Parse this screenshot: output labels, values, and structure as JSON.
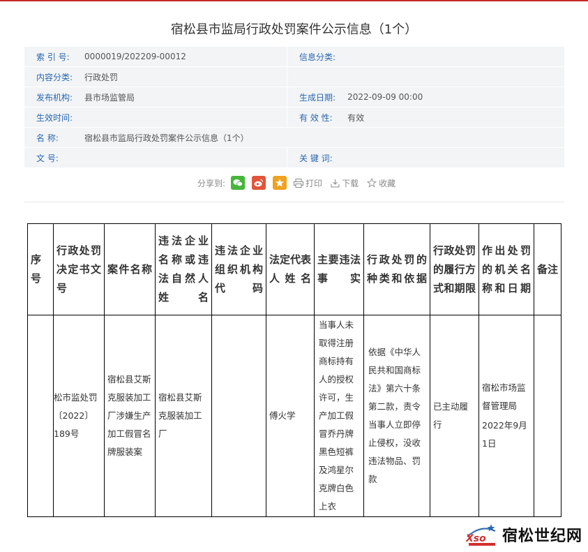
{
  "title": "宿松县市监局行政处罚案件公示信息（1个）",
  "meta": {
    "rows": [
      {
        "k1": "索 引 号:",
        "v1": "0000019/202209-00012",
        "k2": "信息分类:",
        "v2": ""
      },
      {
        "k1": "内容分类:",
        "v1": "行政处罚",
        "k2": "",
        "v2": ""
      },
      {
        "k1": "发布机构:",
        "v1": "县市场监管局",
        "k2": "生成日期:",
        "v2": "2022-09-09 00:00"
      },
      {
        "k1": "生效时间:",
        "v1": "",
        "k2": "有 效 性:",
        "v2": "有效"
      },
      {
        "k1": "名 称:",
        "v1": "宿松县市监局行政处罚案件公示信息（1个）",
        "k2": "",
        "v2": ""
      },
      {
        "k1": "文 号:",
        "v1": "",
        "k2": "关 键 词:",
        "v2": ""
      }
    ]
  },
  "share": {
    "label": "分享到:",
    "icons": [
      "wechat-icon",
      "weibo-icon",
      "qzone-icon"
    ],
    "print": "打印",
    "download": "下载",
    "favorite": "收藏",
    "colors": {
      "wechat": "#46b63a",
      "weibo": "#e2553b",
      "qzone": "#f0a21e"
    }
  },
  "table": {
    "headers": [
      "序号",
      "行政处罚决定书文号",
      "案件名称",
      "违法企业名称或违法自然人姓名",
      "违法企业组织机构代码",
      "法定代表人姓名",
      "主要违法事实",
      "行政处罚的种类和依据",
      "行政处罚的履行方式和期限",
      "作出处罚的机关名称和日期",
      "备注"
    ],
    "row": {
      "c0": "",
      "c1": "松市监处罚〔2022〕189号",
      "c2": "宿松县艾斯克服装加工厂涉嫌生产加工假冒名牌服装案",
      "c3": "宿松县艾斯克服装加工厂",
      "c4": "",
      "c5": "傅火学",
      "c6": "当事人未取得注册商标持有人的授权许可，生产加工假冒乔丹牌黑色短裤及鸿星尔克牌白色上衣",
      "c7": "依据《中华人民共和国商标法》第六十条第二款，责令当事人立即停止侵权，没收违法物品、罚款",
      "c8": "已主动履行",
      "c9a": "宿松市场监督管理局",
      "c9b": "2022年9月1日",
      "c10": ""
    }
  },
  "watermark": {
    "logo_text": "Xso",
    "site_name": "宿松世纪网"
  }
}
